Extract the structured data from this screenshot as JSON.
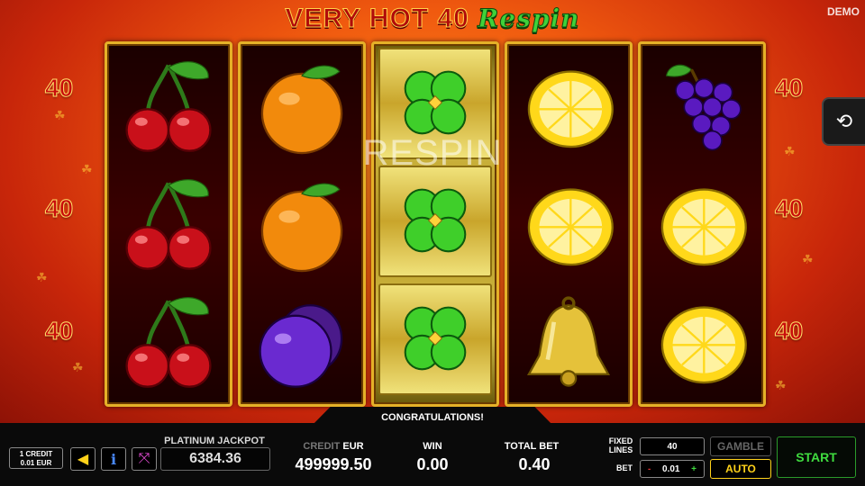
{
  "game": {
    "title_main": "VERY HOT 40",
    "title_accent": "Respin",
    "demo_label": "DEMO",
    "lines_marker": "40",
    "respin_overlay": "RESPIN",
    "message": "CONGRATULATIONS!"
  },
  "reels": [
    [
      "cherry",
      "cherry",
      "cherry"
    ],
    [
      "orange",
      "orange",
      "plum"
    ],
    [
      "clover",
      "clover",
      "clover"
    ],
    [
      "lemon",
      "lemon",
      "bell"
    ],
    [
      "grapes",
      "lemon",
      "lemon"
    ]
  ],
  "panel": {
    "credit_value_label": "1 CREDIT",
    "credit_value_amount": "0.01 EUR",
    "jackpot_label": "PLATINUM JACKPOT",
    "jackpot_value": "6384.36",
    "credit_label": "CREDIT",
    "credit_currency": "EUR",
    "credit_value": "499999.50",
    "win_label": "WIN",
    "win_value": "0.00",
    "total_bet_label": "TOTAL BET",
    "total_bet_value": "0.40",
    "fixed_lines_label": "FIXED LINES",
    "fixed_lines_value": "40",
    "bet_label": "BET",
    "bet_value": "0.01",
    "bet_minus": "-",
    "bet_plus": "+",
    "gamble_label": "GAMBLE",
    "auto_label": "AUTO",
    "start_label": "START"
  },
  "colors": {
    "accent_gold": "#e5b128",
    "start_green": "#3fdb3f",
    "auto_yellow": "#ffd21a"
  }
}
